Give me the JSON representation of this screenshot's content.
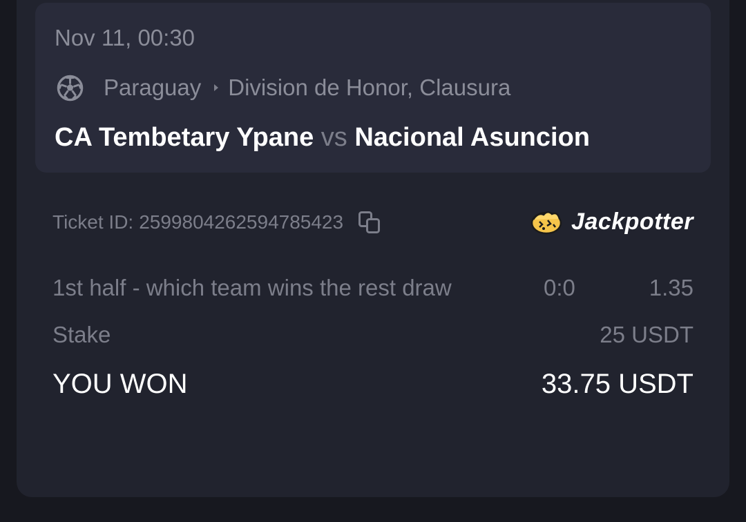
{
  "event": {
    "date_time": "Nov 11, 00:30",
    "sport_icon": "soccer-ball-icon",
    "country": "Paraguay",
    "league": "Division de Honor, Clausura",
    "home_team": "CA Tembetary Ypane",
    "vs": "vs",
    "away_team": "Nacional Asuncion"
  },
  "ticket": {
    "label": "Ticket ID:",
    "id": "2599804262594785423",
    "copy_icon": "copy-icon"
  },
  "brand": {
    "name": "Jackpotter",
    "logo_icon": "jackpotter-logo-icon"
  },
  "bet": {
    "market": "1st half - which team wins the rest draw",
    "score": "0:0",
    "odds": "1.35"
  },
  "stake": {
    "label": "Stake",
    "value": "25 USDT"
  },
  "result": {
    "label": "YOU WON",
    "value": "33.75 USDT"
  },
  "colors": {
    "page_background": "#17181f",
    "card_background": "#21232e",
    "event_box_background": "#292b3a",
    "primary_text": "#ffffff",
    "muted_text": "#7c7e8a",
    "brand_logo_yellow": "#f5c44a"
  }
}
